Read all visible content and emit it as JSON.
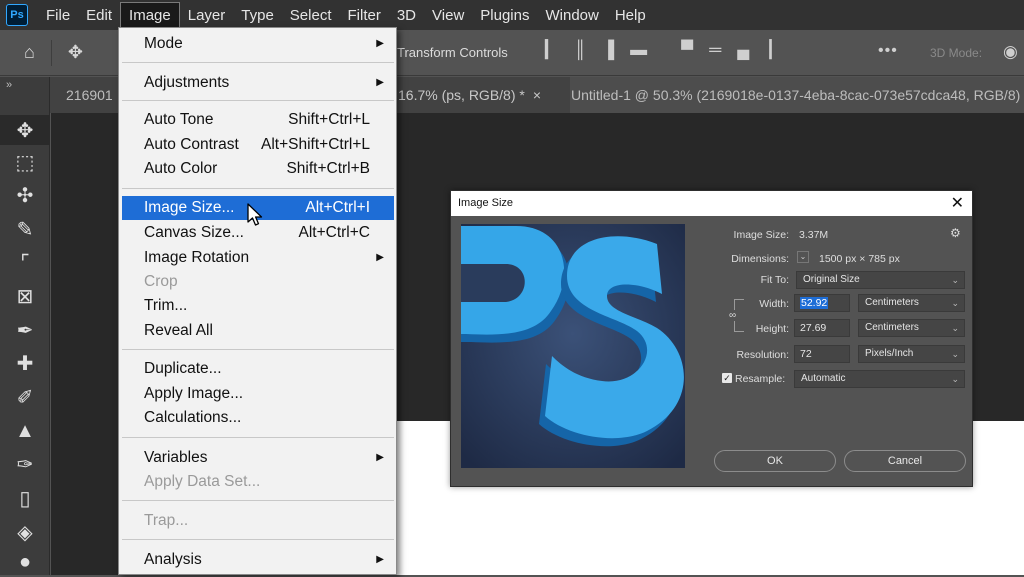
{
  "app": {
    "logo": "Ps"
  },
  "menubar": {
    "items": [
      "File",
      "Edit",
      "Image",
      "Layer",
      "Type",
      "Select",
      "Filter",
      "3D",
      "View",
      "Plugins",
      "Window",
      "Help"
    ],
    "active": "Image"
  },
  "options": {
    "transform_label": "Transform Controls",
    "mode3d_label": "3D Mode:"
  },
  "tabs": [
    {
      "label": "216901"
    },
    {
      "label": "16.7% (ps, RGB/8) *",
      "close": "×"
    },
    {
      "label": "Untitled-1 @ 50.3% (2169018e-0137-4eba-8cac-073e57cdca48, RGB/8) *"
    }
  ],
  "image_menu": {
    "mode": "Mode",
    "adjustments": "Adjustments",
    "auto_tone": "Auto Tone",
    "auto_tone_sc": "Shift+Ctrl+L",
    "auto_contrast": "Auto Contrast",
    "auto_contrast_sc": "Alt+Shift+Ctrl+L",
    "auto_color": "Auto Color",
    "auto_color_sc": "Shift+Ctrl+B",
    "image_size": "Image Size...",
    "image_size_sc": "Alt+Ctrl+I",
    "canvas_size": "Canvas Size...",
    "canvas_size_sc": "Alt+Ctrl+C",
    "image_rotation": "Image Rotation",
    "crop": "Crop",
    "trim": "Trim...",
    "reveal_all": "Reveal All",
    "duplicate": "Duplicate...",
    "apply_image": "Apply Image...",
    "calculations": "Calculations...",
    "variables": "Variables",
    "apply_data_set": "Apply Data Set...",
    "trap": "Trap...",
    "analysis": "Analysis"
  },
  "dialog": {
    "title": "Image Size",
    "close": "✕",
    "image_size_label": "Image Size:",
    "image_size_value": "3.37M",
    "dimensions_label": "Dimensions:",
    "dimensions_value": "1500 px  ×  785 px",
    "fit_to_label": "Fit To:",
    "fit_to_value": "Original Size",
    "width_label": "Width:",
    "width_value": "52.92",
    "width_unit": "Centimeters",
    "height_label": "Height:",
    "height_value": "27.69",
    "height_unit": "Centimeters",
    "resolution_label": "Resolution:",
    "resolution_value": "72",
    "resolution_unit": "Pixels/Inch",
    "resample_label": "Resample:",
    "resample_value": "Automatic",
    "resample_checked": true,
    "ok_label": "OK",
    "cancel_label": "Cancel"
  }
}
